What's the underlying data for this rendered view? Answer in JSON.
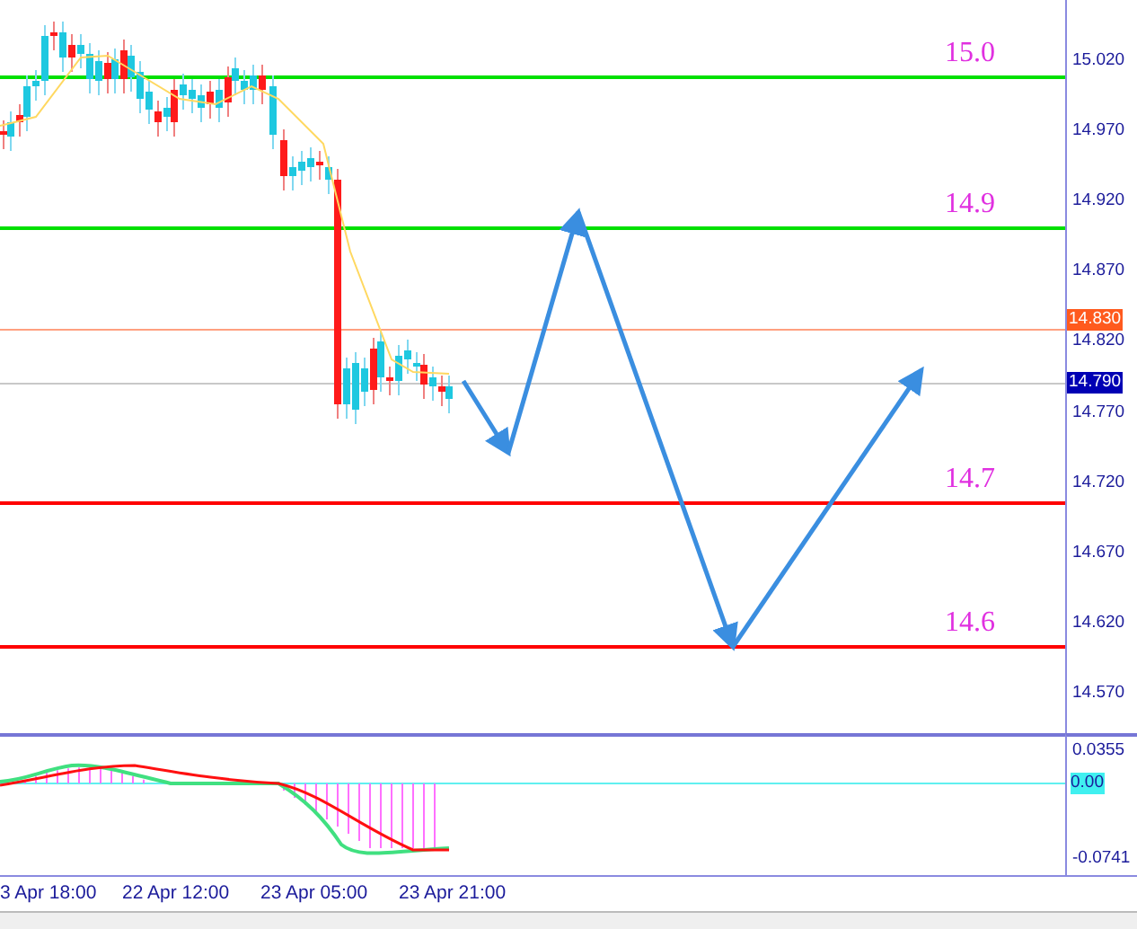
{
  "levels": [
    {
      "label": "15.0",
      "color": "#00e000"
    },
    {
      "label": "14.9",
      "color": "#00e000"
    },
    {
      "label": "14.7",
      "color": "#ff0000"
    },
    {
      "label": "14.6",
      "color": "#ff0000"
    }
  ],
  "price_axis": {
    "labels": [
      "15.020",
      "14.970",
      "14.920",
      "14.870",
      "14.820",
      "14.770",
      "14.720",
      "14.670",
      "14.620",
      "14.570"
    ],
    "markers": [
      {
        "text": "14.830",
        "color": "#ff5a1e"
      },
      {
        "text": "14.790",
        "color": "#0000b4"
      }
    ]
  },
  "indicator_axis": {
    "labels": [
      "0.0355",
      "0.00",
      "-0.0741"
    ]
  },
  "time_axis": {
    "labels": [
      "3 Apr 18:00",
      "22 Apr 12:00",
      "23 Apr 05:00",
      "23 Apr 21:00"
    ]
  }
}
